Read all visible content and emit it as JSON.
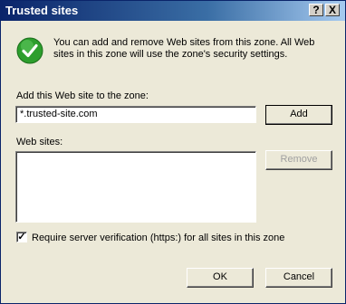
{
  "window": {
    "title": "Trusted sites",
    "help_glyph": "?",
    "close_glyph": "X"
  },
  "info": {
    "icon": "green-checkmark-icon",
    "text": "You can add and remove Web sites from this zone. All Web sites in this zone will use the zone's security settings."
  },
  "add_site": {
    "label": "Add this Web site to the zone:",
    "value": "*.trusted-site.com",
    "button_label": "Add"
  },
  "web_sites": {
    "label": "Web sites:",
    "items": [],
    "remove_label": "Remove"
  },
  "verification": {
    "checked": true,
    "check_glyph": "✓",
    "label": "Require server verification (https:) for all sites in this zone"
  },
  "footer": {
    "ok_label": "OK",
    "cancel_label": "Cancel"
  },
  "colors": {
    "titlebar_start": "#0a246a",
    "titlebar_end": "#a6caf0",
    "dialog_bg": "#ece9d8",
    "icon_green": "#2d9e2d"
  }
}
